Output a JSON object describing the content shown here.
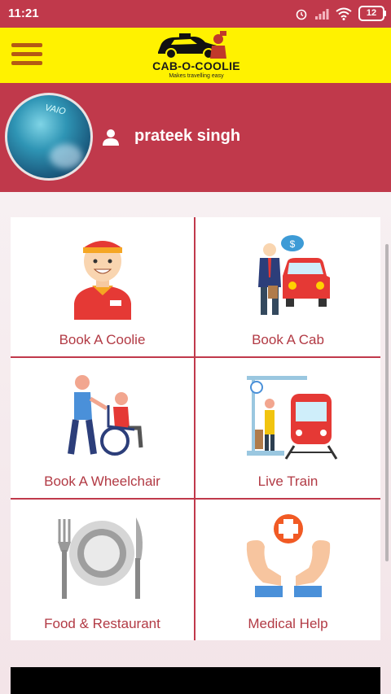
{
  "status_bar": {
    "time": "11:21",
    "battery": "12"
  },
  "app": {
    "title": "CAB-O-COOLIE",
    "tagline": "Makes travelling easy"
  },
  "profile": {
    "name": "prateek singh",
    "avatar_brand": "VAIO"
  },
  "services": [
    {
      "label": "Book A Coolie",
      "icon": "coolie-icon"
    },
    {
      "label": "Book A Cab",
      "icon": "cab-icon"
    },
    {
      "label": "Book A Wheelchair",
      "icon": "wheelchair-icon"
    },
    {
      "label": "Live Train",
      "icon": "train-icon"
    },
    {
      "label": "Food & Restaurant",
      "icon": "food-icon"
    },
    {
      "label": "Medical Help",
      "icon": "medical-icon"
    }
  ],
  "colors": {
    "primary": "#c0394b",
    "appbar": "#fff200",
    "menu": "#b45a14",
    "label": "#b23a44"
  }
}
